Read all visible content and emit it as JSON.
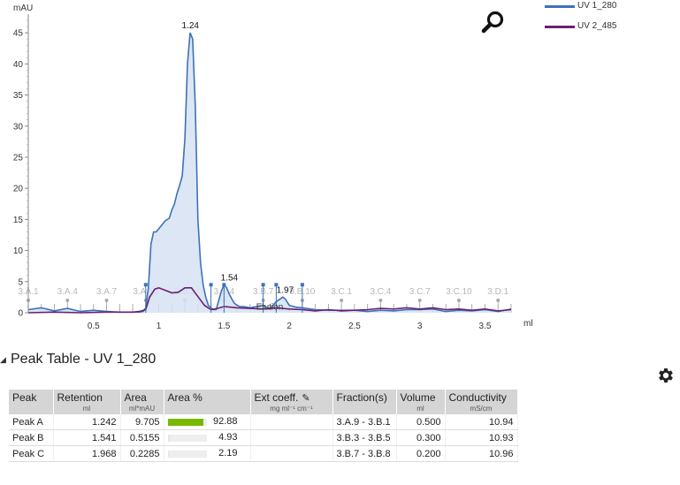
{
  "chart_data": {
    "type": "line",
    "ylabel": "mAU",
    "xlabel": "ml",
    "xlim": [
      0,
      3.7
    ],
    "ylim": [
      0,
      48
    ],
    "xticks": [
      0.5,
      1,
      1.5,
      2,
      2.5,
      3,
      3.5
    ],
    "xtick_labels": [
      "0.5",
      "1",
      "1.5",
      "2",
      "2.5",
      "3",
      "3.5"
    ],
    "yticks": [
      0,
      5,
      10,
      15,
      20,
      25,
      30,
      35,
      40,
      45
    ],
    "ytick_labels": [
      "0",
      "5",
      "10",
      "15",
      "20",
      "25",
      "30",
      "35",
      "40",
      "45"
    ],
    "series": [
      {
        "name": "UV 1_280",
        "color": "#3d72b8",
        "fill": "#d6e2f2",
        "x": [
          0,
          0.1,
          0.2,
          0.3,
          0.4,
          0.5,
          0.6,
          0.7,
          0.8,
          0.85,
          0.88,
          0.9,
          0.92,
          0.94,
          0.96,
          0.98,
          1.0,
          1.02,
          1.05,
          1.08,
          1.1,
          1.12,
          1.14,
          1.16,
          1.18,
          1.2,
          1.22,
          1.24,
          1.26,
          1.28,
          1.3,
          1.32,
          1.34,
          1.36,
          1.38,
          1.4,
          1.42,
          1.44,
          1.46,
          1.48,
          1.5,
          1.52,
          1.54,
          1.56,
          1.58,
          1.6,
          1.62,
          1.65,
          1.7,
          1.75,
          1.8,
          1.85,
          1.9,
          1.95,
          1.97,
          2.0,
          2.05,
          2.1,
          2.2,
          2.3,
          2.4,
          2.5,
          2.6,
          2.7,
          2.8,
          2.9,
          3.0,
          3.1,
          3.2,
          3.3,
          3.4,
          3.5,
          3.6,
          3.7
        ],
        "y": [
          0.5,
          0.8,
          0.3,
          0.7,
          0.2,
          0.4,
          0.2,
          0.1,
          0.1,
          0.1,
          0.2,
          0.8,
          4,
          11,
          13,
          13,
          13.5,
          14,
          14.8,
          15.2,
          16.5,
          17.5,
          19.2,
          20.5,
          22,
          28,
          40,
          45,
          44,
          33,
          15,
          8,
          4.5,
          2.5,
          1.2,
          0.8,
          0.5,
          0.5,
          2,
          3.5,
          4.5,
          4,
          3,
          2.2,
          1.5,
          1.2,
          1,
          1,
          0.8,
          1,
          1.2,
          0.6,
          1.8,
          2.5,
          2.2,
          1.2,
          0.9,
          0.8,
          0.5,
          0.4,
          0.4,
          0.4,
          0.2,
          0.4,
          0.3,
          0.5,
          0.5,
          0.6,
          0.2,
          0.4,
          0.3,
          0.5,
          0.2,
          0.6
        ]
      },
      {
        "name": "UV 2_485",
        "color": "#6b2070",
        "x": [
          0,
          0.2,
          0.4,
          0.6,
          0.8,
          0.85,
          0.9,
          0.93,
          0.97,
          1.0,
          1.05,
          1.1,
          1.15,
          1.2,
          1.25,
          1.3,
          1.35,
          1.4,
          1.45,
          1.5,
          1.55,
          1.6,
          1.7,
          1.8,
          1.9,
          2.0,
          2.1,
          2.2,
          2.3,
          2.4,
          2.5,
          2.6,
          2.7,
          2.8,
          2.9,
          3.0,
          3.1,
          3.2,
          3.3,
          3.4,
          3.5,
          3.6,
          3.7
        ],
        "y": [
          0,
          0.1,
          0,
          0.1,
          0.1,
          0.2,
          0.5,
          2.5,
          3.8,
          4,
          3.6,
          3.2,
          3.3,
          4,
          4,
          2.6,
          1.2,
          0.5,
          0.7,
          1,
          0.9,
          0.8,
          0.7,
          0.6,
          0.8,
          0.6,
          0.5,
          0.3,
          0.5,
          0.3,
          0.4,
          0.5,
          0.7,
          0.6,
          0.8,
          0.6,
          0.8,
          0.5,
          0.6,
          0.4,
          0.6,
          0.3,
          0.5
        ]
      }
    ],
    "peak_labels": [
      {
        "text": "1.24",
        "x": 1.242,
        "y": 45
      },
      {
        "text": "1.54",
        "x": 1.541,
        "y": 4.5
      },
      {
        "text": "1.97",
        "x": 1.968,
        "y": 2.5
      }
    ],
    "peak_markers": [
      {
        "x": 0.9,
        "type": "square"
      },
      {
        "x": 1.4,
        "type": "square"
      },
      {
        "x": 1.5,
        "type": "square"
      },
      {
        "x": 1.8,
        "type": "square"
      },
      {
        "x": 1.9,
        "type": "square"
      },
      {
        "x": 2.1,
        "type": "square"
      }
    ],
    "fractions": [
      {
        "label": "3.A.1",
        "x": 0.0
      },
      {
        "label": "3.A.4",
        "x": 0.3
      },
      {
        "label": "3.A.7",
        "x": 0.6
      },
      {
        "label": "3.A.10",
        "x": 0.9
      },
      {
        "label": "3.B.1",
        "x": 1.2
      },
      {
        "label": "3.B.4",
        "x": 1.5
      },
      {
        "label": "3.B.7",
        "x": 1.8
      },
      {
        "label": "3.B.10",
        "x": 2.1
      },
      {
        "label": "3.C.1",
        "x": 2.4
      },
      {
        "label": "3.C.4",
        "x": 2.7
      },
      {
        "label": "3.C.7",
        "x": 3.0
      },
      {
        "label": "3.C.10",
        "x": 3.3
      },
      {
        "label": "3.D.1",
        "x": 3.6
      }
    ],
    "fraction_tick_step": 0.1,
    "annotation": {
      "text": "Elution",
      "x": 1.85,
      "y": 0.5
    },
    "legend_position": "top-right"
  },
  "legend": {
    "items": [
      {
        "label": "UV 1_280",
        "color": "#3d72b8"
      },
      {
        "label": "UV 2_485",
        "color": "#6b2070"
      }
    ]
  },
  "icons": {
    "zoom": "magnifier-icon",
    "settings": "gear-icon",
    "collapse": "collapse-triangle-icon",
    "edit": "pencil-icon"
  },
  "section": {
    "title": "Peak Table - UV 1_280"
  },
  "table": {
    "headers": [
      {
        "label": "Peak",
        "unit": ""
      },
      {
        "label": "Retention",
        "unit": "ml"
      },
      {
        "label": "Area",
        "unit": "ml*mAU"
      },
      {
        "label": "Area %",
        "unit": ""
      },
      {
        "label": "Ext coeff.",
        "unit": "mg ml⁻¹ cm⁻¹"
      },
      {
        "label": "Fraction(s)",
        "unit": ""
      },
      {
        "label": "Volume",
        "unit": "ml"
      },
      {
        "label": "Conductivity",
        "unit": "mS/cm"
      }
    ],
    "rows": [
      {
        "peak": "Peak A",
        "retention": "1.242",
        "area": "9.705",
        "area_pct": "92.88",
        "area_pct_value": 92.88,
        "ext": "",
        "fractions": "3.A.9 - 3.B.1",
        "volume": "0.500",
        "conductivity": "10.94"
      },
      {
        "peak": "Peak B",
        "retention": "1.541",
        "area": "0.5155",
        "area_pct": "4.93",
        "area_pct_value": 4.93,
        "ext": "",
        "fractions": "3.B.3 - 3.B.5",
        "volume": "0.300",
        "conductivity": "10.93"
      },
      {
        "peak": "Peak C",
        "retention": "1.968",
        "area": "0.2285",
        "area_pct": "2.19",
        "area_pct_value": 2.19,
        "ext": "",
        "fractions": "3.B.7 - 3.B.8",
        "volume": "0.200",
        "conductivity": "10.96"
      }
    ]
  }
}
